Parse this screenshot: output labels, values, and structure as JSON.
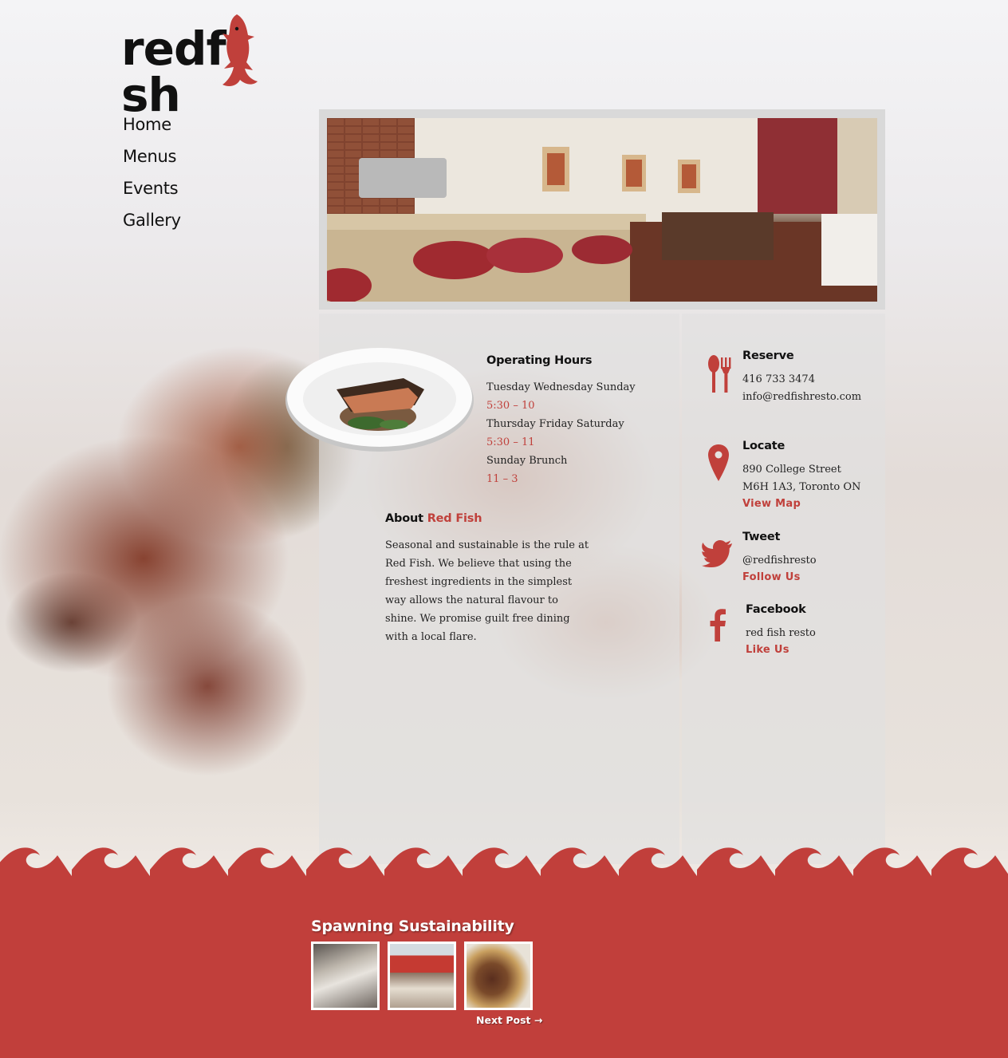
{
  "brand": {
    "logo_text_left": "redf",
    "logo_text_right": "sh",
    "accent_color": "#c0403b",
    "footer_color": "#c13f3b"
  },
  "nav": {
    "items": [
      {
        "label": "Home"
      },
      {
        "label": "Menus"
      },
      {
        "label": "Events"
      },
      {
        "label": "Gallery"
      }
    ]
  },
  "hours": {
    "title": "Operating Hours",
    "rows": [
      {
        "days": "Tuesday Wednesday Sunday",
        "time": "5:30 – 10"
      },
      {
        "days": "Thursday Friday Saturday",
        "time": "5:30 – 11"
      },
      {
        "days": "Sunday Brunch",
        "time": "11 – 3"
      }
    ]
  },
  "about": {
    "title_prefix": "About",
    "title_highlight": "Red Fish",
    "body": "Seasonal and sustainable is the rule at Red Fish. We believe that using the freshest ingredients in the simplest way allows the natural flavour to shine.  We promise guilt free dining with a local flare."
  },
  "contact": {
    "reserve": {
      "title": "Reserve",
      "phone": "416 733 3474",
      "email": "info@redfishresto.com",
      "icon": "fork-knife-icon"
    },
    "locate": {
      "title": "Locate",
      "address_line1": "890 College Street",
      "address_line2": "M6H 1A3, Toronto ON",
      "link": "View  Map",
      "icon": "map-pin-icon"
    },
    "tweet": {
      "title": "Tweet",
      "handle": "@redfishresto",
      "link": "Follow  Us",
      "icon": "twitter-bird-icon"
    },
    "facebook": {
      "title": "Facebook",
      "name": "red fish resto",
      "link": "Like  Us",
      "icon": "facebook-icon"
    }
  },
  "footer": {
    "title": "Spawning  Sustainability",
    "next_link": "Next Post →"
  }
}
